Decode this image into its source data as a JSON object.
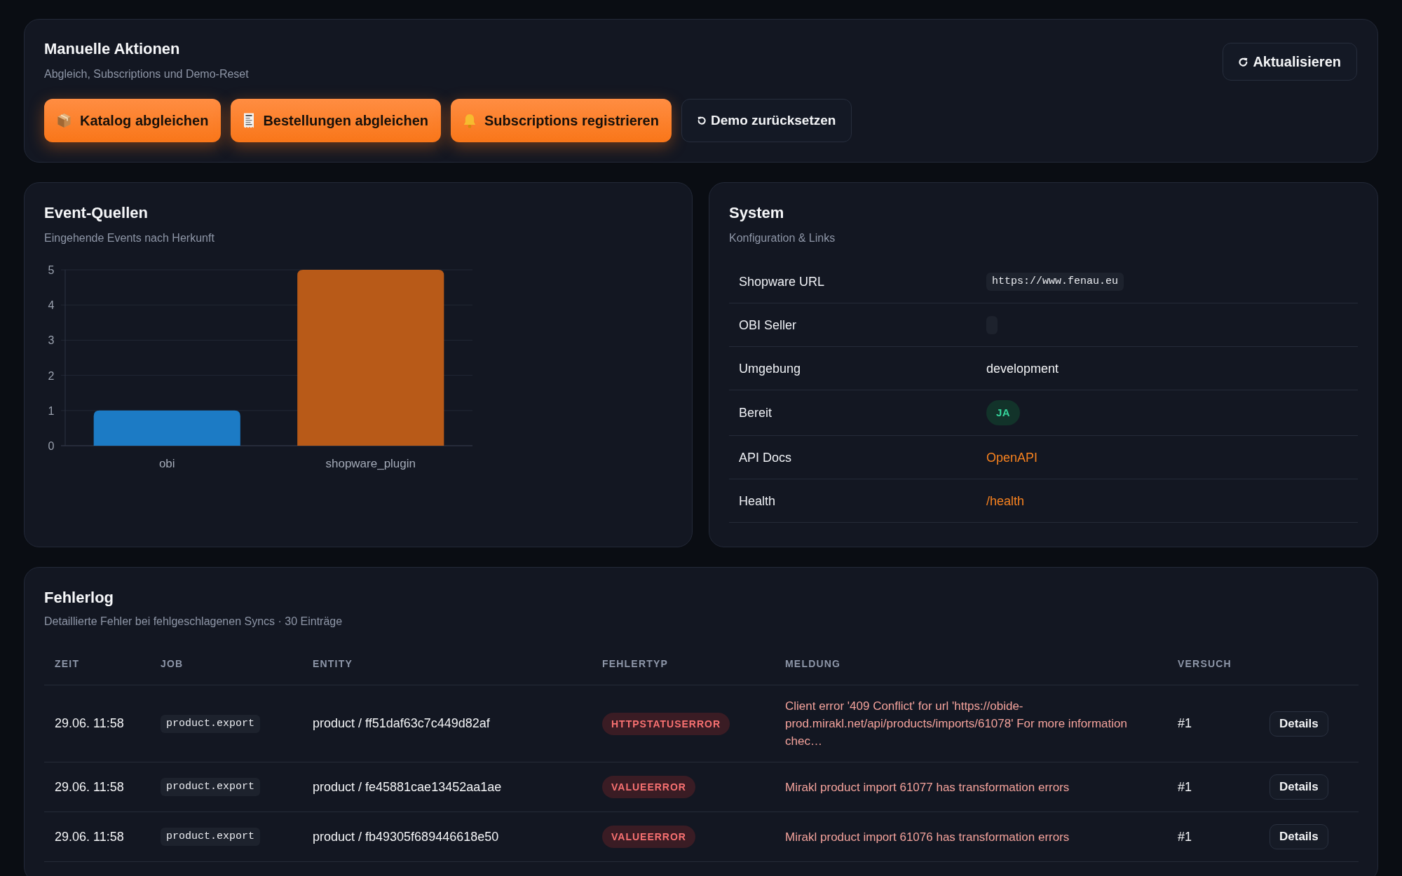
{
  "actions_card": {
    "title": "Manuelle Aktionen",
    "subtitle": "Abgleich, Subscriptions und Demo-Reset",
    "refresh_button": "Aktualisieren",
    "buttons": [
      {
        "label": "Katalog abgleichen",
        "kind": "primary"
      },
      {
        "label": "Bestellungen abgleichen",
        "kind": "primary"
      },
      {
        "label": "Subscriptions registrieren",
        "kind": "primary"
      },
      {
        "label": "Demo zurücksetzen",
        "kind": "secondary"
      }
    ]
  },
  "event_sources": {
    "title": "Event-Quellen",
    "subtitle": "Eingehende Events nach Herkunft",
    "chart_data": {
      "type": "bar",
      "categories": [
        "obi",
        "shopware_plugin"
      ],
      "values": [
        1,
        5
      ],
      "colors": [
        "#1c7bc5",
        "#b85a18"
      ],
      "ylim": [
        0,
        5
      ],
      "yticks": [
        0,
        1,
        2,
        3,
        4,
        5
      ],
      "grid": true
    }
  },
  "system": {
    "title": "System",
    "subtitle": "Konfiguration & Links",
    "rows": [
      {
        "label": "Shopware URL",
        "kind": "code",
        "value": "https://www.fenau.eu"
      },
      {
        "label": "OBI Seller",
        "kind": "code"
      },
      {
        "label": "Umgebung",
        "kind": "text",
        "value": "development"
      },
      {
        "label": "Bereit",
        "kind": "badge",
        "value": "JA",
        "ok": true
      },
      {
        "label": "API Docs",
        "kind": "link",
        "value": "OpenAPI"
      },
      {
        "label": "Health",
        "kind": "link",
        "value": "/health"
      }
    ]
  },
  "error_log": {
    "title": "Fehlerlog",
    "subtitle": "Detaillierte Fehler bei fehlgeschlagenen Syncs · 30 Einträge",
    "columns": [
      "ZEIT",
      "JOB",
      "ENTITY",
      "FEHLERTYP",
      "MELDUNG",
      "VERSUCH"
    ],
    "rows": [
      {
        "time": "29.06. 11:58",
        "job": "product.export",
        "entity": "product / ff51daf63c7c449d82af",
        "error_type": "HTTPSTATUSERROR",
        "message": "Client error '409 Conflict' for url 'https://obide-prod.mirakl.net/api/products/imports/61078' For more information chec…",
        "attempt": "#1",
        "action": "Details"
      },
      {
        "time": "29.06. 11:58",
        "job": "product.export",
        "entity": "product / fe45881cae13452aa1ae",
        "error_type": "VALUEERROR",
        "message": "Mirakl product import 61077 has transformation errors",
        "attempt": "#1",
        "action": "Details"
      },
      {
        "time": "29.06. 11:58",
        "job": "product.export",
        "entity": "product / fb49305f689446618e50",
        "error_type": "VALUEERROR",
        "message": "Mirakl product import 61076 has transformation errors",
        "attempt": "#1",
        "action": "Details"
      }
    ]
  }
}
